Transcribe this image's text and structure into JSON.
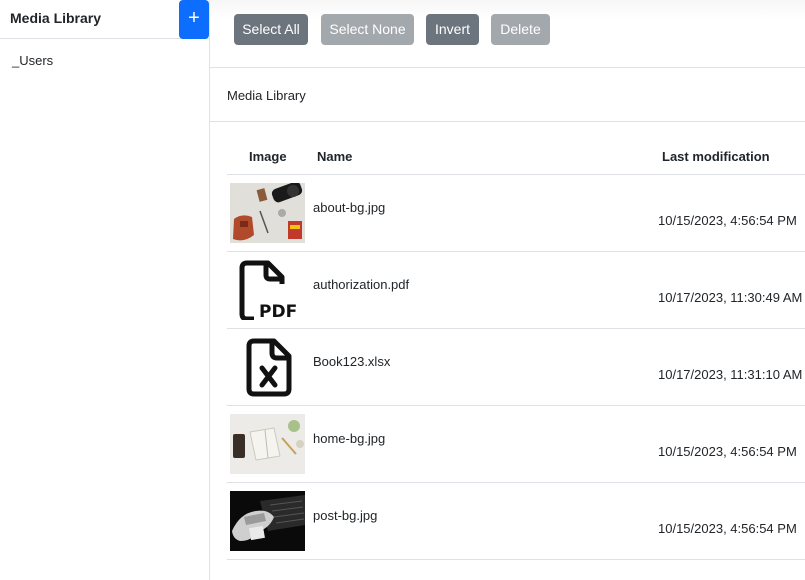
{
  "sidebar": {
    "title": "Media Library",
    "add_label": "+",
    "items": [
      {
        "label": "_Users"
      }
    ]
  },
  "toolbar": {
    "select_all": "Select All",
    "select_none": "Select None",
    "invert": "Invert",
    "delete": "Delete"
  },
  "breadcrumb": "Media Library",
  "table": {
    "headers": [
      "Image",
      "Name",
      "Last modification"
    ],
    "rows": [
      {
        "name": "about-bg.jpg",
        "modified": "10/15/2023, 4:56:54 PM",
        "thumb": "photo-desk"
      },
      {
        "name": "authorization.pdf",
        "modified": "10/17/2023, 11:30:49 AM",
        "thumb": "pdf-file-icon"
      },
      {
        "name": "Book123.xlsx",
        "modified": "10/17/2023, 11:31:10 AM",
        "thumb": "excel-file-icon"
      },
      {
        "name": "home-bg.jpg",
        "modified": "10/15/2023, 4:56:54 PM",
        "thumb": "photo-notebook"
      },
      {
        "name": "post-bg.jpg",
        "modified": "10/15/2023, 4:56:54 PM",
        "thumb": "photo-hand-laptop"
      }
    ]
  },
  "colors": {
    "primary": "#0d6efd",
    "secondary": "#6c757d",
    "secondary_disabled": "#a3a8ad"
  }
}
